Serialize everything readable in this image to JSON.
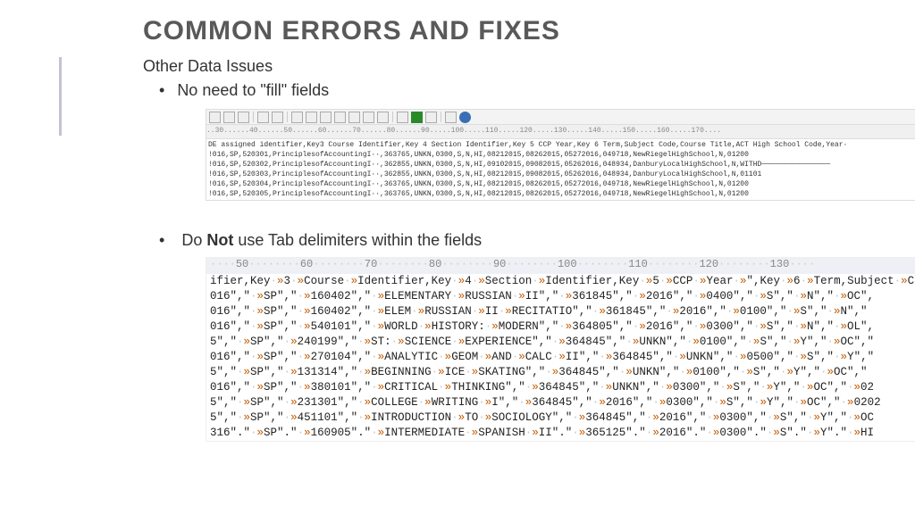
{
  "title": "COMMON ERRORS AND FIXES",
  "subhead": "Other Data Issues",
  "bullet1": "No need to \"fill\" fields",
  "bullet2_pre": "Do ",
  "bullet2_bold": "Not",
  "bullet2_post": " use Tab delimiters within the fields",
  "ruler1": "..30......40......50......60......70......80......90.....100.....110.....120.....130.....140.....150.....160.....170....",
  "code1": [
    "DE assigned identifier,Key3 Course Identifier,Key 4 Section Identifier,Key 5 CCP Year,Key 6 Term,Subject Code,Course Title,ACT High School Code,Year·",
    "!016,SP,520301,PrinciplesofAccountingI··,363765,UNKN,0300,S,N,HI,08212015,08262015,05272016,049718,NewRiegelHighSchool,N,01200",
    "!016,SP,520302,PrinciplesofAccountingI··,362855,UNKN,0300,S,N,HI,09102015,09082015,05262016,048934,DanburyLocalHighSchool,N,WITHD────────────────",
    "!016,SP,520303,PrinciplesofAccountingI··,362855,UNKN,0300,S,N,HI,08212015,09082015,05262016,048934,DanburyLocalHighSchool,N,01101",
    "!016,SP,520304,PrinciplesofAccountingI··,363765,UNKN,0300,S,N,HI,08212015,08262015,05272016,049718,NewRiegelHighSchool,N,01200",
    "!016,SP,520305,PrinciplesofAccountingI··,363765,UNKN,0300,S,N,HI,08212015,08262015,05272016,049718,NewRiegelHighSchool,N,01200"
  ],
  "ruler2_ticks": [
    50,
    60,
    70,
    80,
    90,
    100,
    110,
    120,
    130
  ],
  "code2": [
    [
      "ifier,Key",
      "3",
      "Course",
      "Identifier,Key",
      "4",
      "Section",
      "Identifier,Key",
      "5",
      "CCP",
      "Year",
      "\",Key",
      "6",
      "Term,Subject",
      "C"
    ],
    [
      "016\",\"",
      "SP\",\"",
      "160402\",\"",
      "ELEMENTARY",
      "RUSSIAN",
      "II\",\"",
      "361845\",\"",
      "2016\",\"",
      "0400\",\"",
      "S\",\"",
      "N\",\"",
      "OC\","
    ],
    [
      "016\",\"",
      "SP\",\"",
      "160402\",\"",
      "ELEM",
      "RUSSIAN",
      "II",
      "RECITATIO\",\"",
      "361845\",\"",
      "2016\",\"",
      "0100\",\"",
      "S\",\"",
      "N\",\""
    ],
    [
      "016\",\"",
      "SP\",\"",
      "540101\",\"",
      "WORLD",
      "HISTORY:",
      "MODERN\",\"",
      "364805\",\"",
      "2016\",\"",
      "0300\",\"",
      "S\",\"",
      "N\",\"",
      "OL\","
    ],
    [
      "5\",\"",
      "SP\",\"",
      "240199\",\"",
      "ST:",
      "SCIENCE",
      "EXPERIENCE\",\"",
      "364845\",\"",
      "UNKN\",\"",
      "0100\",\"",
      "S\",\"",
      "Y\",\"",
      "OC\",\""
    ],
    [
      "016\",\"",
      "SP\",\"",
      "270104\",\"",
      "ANALYTIC",
      "GEOM",
      "AND",
      "CALC",
      "II\",\"",
      "364845\",\"",
      "UNKN\",\"",
      "0500\",\"",
      "S\",\"",
      "Y\",\""
    ],
    [
      "5\",\"",
      "SP\",\"",
      "131314\",\"",
      "BEGINNING",
      "ICE",
      "SKATING\",\"",
      "364845\",\"",
      "UNKN\",\"",
      "0100\",\"",
      "S\",\"",
      "Y\",\"",
      "OC\",\""
    ],
    [
      "016\",\"",
      "SP\",\"",
      "380101\",\"",
      "CRITICAL",
      "THINKING\",\"",
      "364845\",\"",
      "UNKN\",\"",
      "0300\",\"",
      "S\",\"",
      "Y\",\"",
      "OC\",\"",
      "02"
    ],
    [
      "5\",\"",
      "SP\",\"",
      "231301\",\"",
      "COLLEGE",
      "WRITING",
      "I\",\"",
      "364845\",\"",
      "2016\",\"",
      "0300\",\"",
      "S\",\"",
      "Y\",\"",
      "OC\",\"",
      "0202"
    ],
    [
      "5\",\"",
      "SP\",\"",
      "451101\",\"",
      "INTRODUCTION",
      "TO",
      "SOCIOLOGY\",\"",
      "364845\",\"",
      "2016\",\"",
      "0300\",\"",
      "S\",\"",
      "Y\",\"",
      "OC"
    ],
    [
      "316\".\"",
      "SP\".\"",
      "160905\".\"",
      "INTERMEDIATE",
      "SPANISH",
      "II\".\"",
      "365125\".\"",
      "2016\".\"",
      "0300\".\"",
      "S\".\"",
      "Y\".\"",
      "HI"
    ]
  ]
}
